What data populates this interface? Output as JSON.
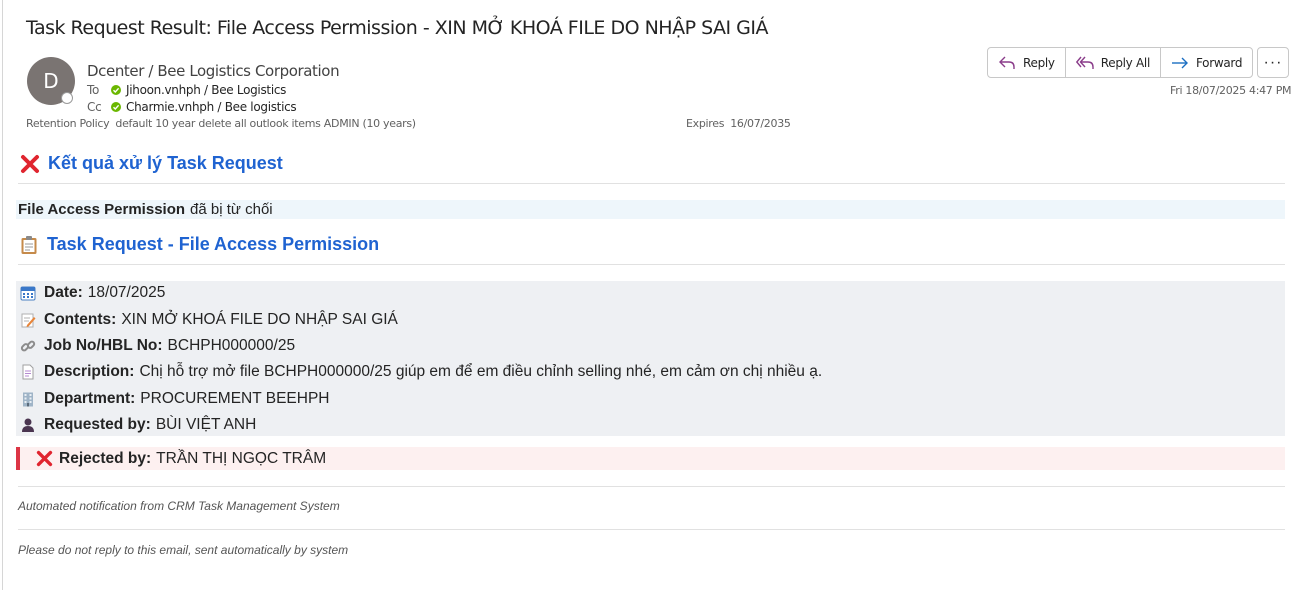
{
  "email": {
    "subject": "Task Request Result: File Access Permission - XIN MỞ KHOÁ FILE DO NHẬP SAI GIÁ",
    "avatar_initial": "D",
    "sender": "Dcenter / Bee Logistics Corporation",
    "to_label": "To",
    "to": "Jihoon.vnhph / Bee Logistics",
    "cc_label": "Cc",
    "cc": "Charmie.vnhph / Bee logistics",
    "retention_label": "Retention Policy",
    "retention_value": "default 10 year delete all outlook items ADMIN (10 years)",
    "expires_label": "Expires",
    "expires_value": "16/07/2035",
    "date": "Fri 18/07/2025 4:47 PM"
  },
  "actions": {
    "reply": "Reply",
    "reply_all": "Reply All",
    "forward": "Forward",
    "more": "···"
  },
  "body": {
    "result_heading": "Kết quả xử lý Task Request",
    "status_bold": "File Access Permission",
    "status_text": "đã bị từ chối",
    "task_heading": "Task Request - File Access Permission",
    "details": [
      {
        "label": "Date:",
        "value": "18/07/2025",
        "icon": "calendar-icon"
      },
      {
        "label": "Contents:",
        "value": "XIN MỞ KHOÁ FILE DO NHẬP SAI GIÁ",
        "icon": "memo-icon"
      },
      {
        "label": "Job No/HBL No:",
        "value": "BCHPH000000/25",
        "icon": "link-icon"
      },
      {
        "label": "Description:",
        "value": "Chị hỗ trợ mở file BCHPH000000/25 giúp em để em điều chỉnh selling nhé, em cảm ơn chị nhiều ạ.",
        "icon": "document-icon"
      },
      {
        "label": "Department:",
        "value": "PROCUREMENT BEEHPH",
        "icon": "office-building-icon"
      },
      {
        "label": "Requested by:",
        "value": "BÙI VIỆT ANH",
        "icon": "person-icon"
      }
    ],
    "rejected_label": "Rejected by:",
    "rejected_value": "TRẦN THỊ NGỌC TRÂM",
    "footer_note": "Automated notification from CRM Task Management System",
    "footer_disclaimer": "Please do not reply to this email, sent automatically by system"
  },
  "colors": {
    "heading_blue": "#1f63d1",
    "reject_red": "#dc3545",
    "presence_green": "#6bb700"
  }
}
